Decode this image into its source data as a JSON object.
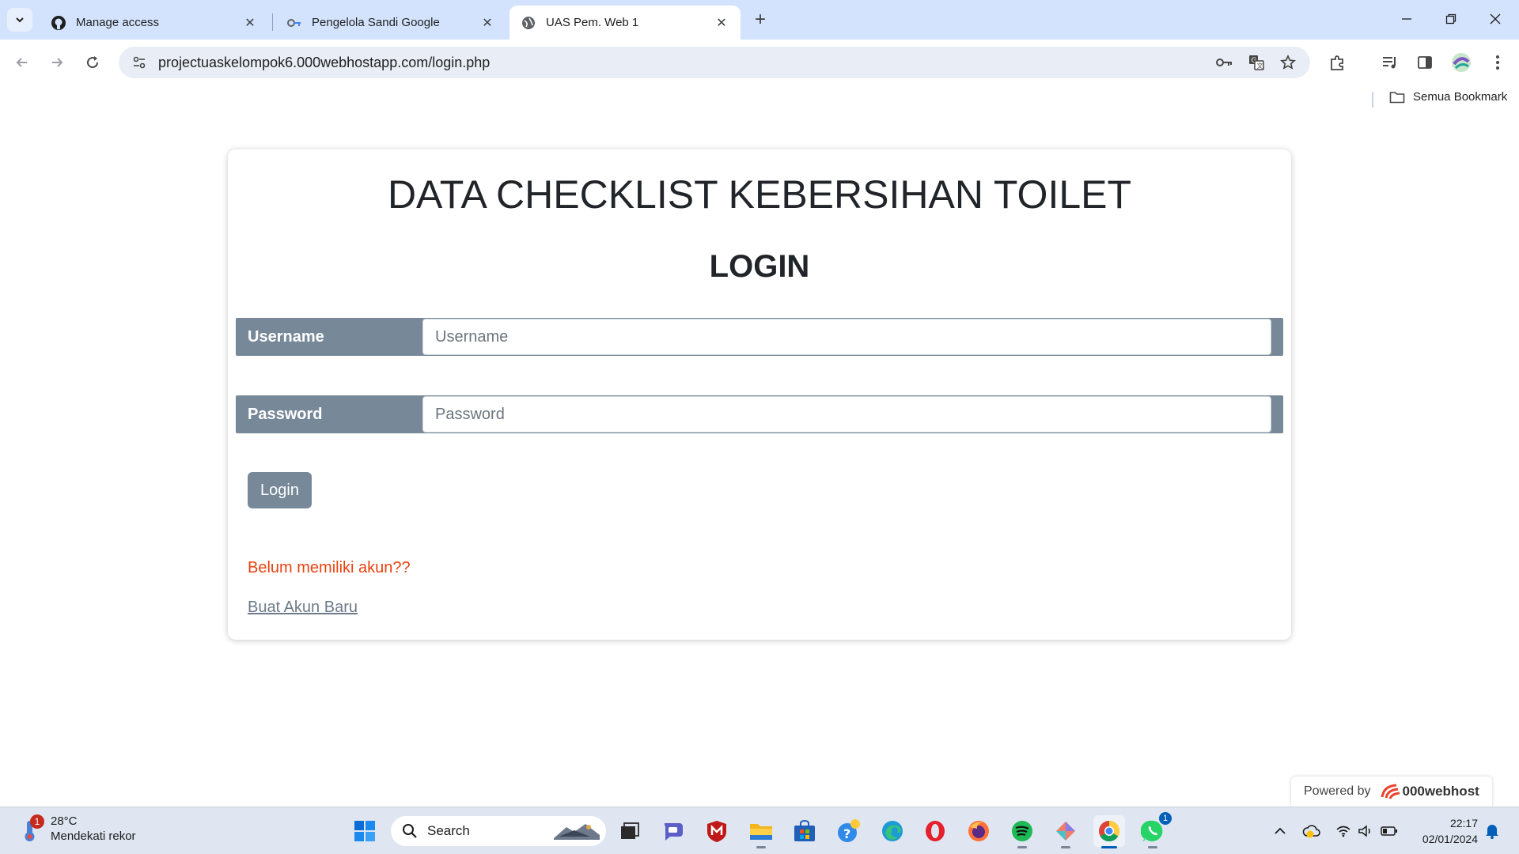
{
  "browser": {
    "tabs": [
      {
        "title": "Manage access",
        "icon": "github-icon",
        "active": false
      },
      {
        "title": "Pengelola Sandi Google",
        "icon": "password-key-icon",
        "active": false
      },
      {
        "title": "UAS Pem. Web 1",
        "icon": "globe-icon",
        "active": true
      }
    ],
    "url": "projectuaskelompok6.000webhostapp.com/login.php",
    "bookmarks_all_label": "Semua Bookmark"
  },
  "page": {
    "heading": "DATA CHECKLIST KEBERSIHAN TOILET",
    "subheading": "LOGIN",
    "username": {
      "label": "Username",
      "placeholder": "Username",
      "value": ""
    },
    "password": {
      "label": "Password",
      "placeholder": "Password",
      "value": ""
    },
    "login_button": "Login",
    "no_account_text": "Belum memiliki akun??",
    "register_link": "Buat Akun Baru",
    "powered_by": "Powered by",
    "powered_brand": "000webhost",
    "colors": {
      "field_bg": "#778899",
      "warning_text": "#e8420f"
    }
  },
  "taskbar": {
    "weather": {
      "temp": "28°C",
      "desc": "Mendekati rekor",
      "badge": "1"
    },
    "search_label": "Search",
    "whatsapp_badge": "1",
    "time": "22:17",
    "date": "02/01/2024"
  }
}
